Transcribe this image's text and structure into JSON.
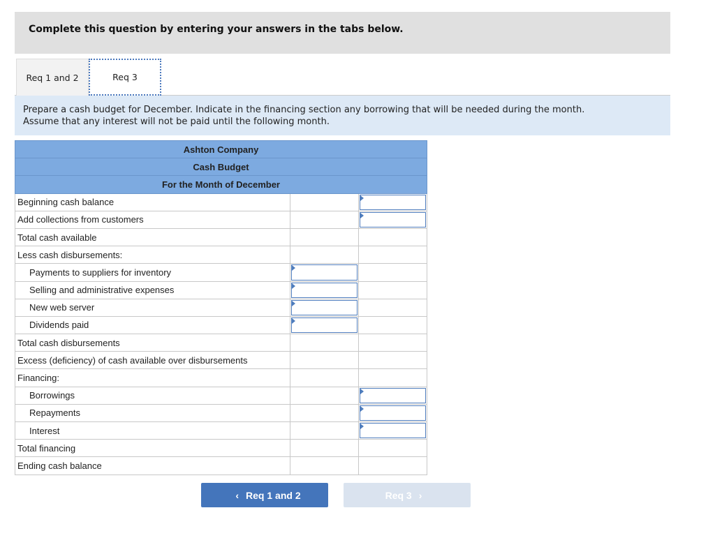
{
  "instruction": "Complete this question by entering your answers in the tabs below.",
  "tabs": [
    {
      "label": "Req 1 and 2",
      "active": false
    },
    {
      "label": "Req 3",
      "active": true
    }
  ],
  "description_line1": "Prepare a cash budget for December. Indicate in the financing section any borrowing that will be needed during the month.",
  "description_line2": "Assume that any interest will not be paid until the following month.",
  "table": {
    "header": [
      "Ashton Company",
      "Cash Budget",
      "For the Month of December"
    ],
    "rows": [
      {
        "label": "Beginning cash balance",
        "indent": false,
        "input_col": 2
      },
      {
        "label": "Add collections from customers",
        "indent": false,
        "input_col": 2
      },
      {
        "label": "Total cash available",
        "indent": false,
        "input_col": 0
      },
      {
        "label": "Less cash disbursements:",
        "indent": false,
        "input_col": 0
      },
      {
        "label": "Payments to suppliers for inventory",
        "indent": true,
        "input_col": 1
      },
      {
        "label": "Selling and administrative expenses",
        "indent": true,
        "input_col": 1
      },
      {
        "label": "New web server",
        "indent": true,
        "input_col": 1
      },
      {
        "label": "Dividends paid",
        "indent": true,
        "input_col": 1
      },
      {
        "label": "Total cash disbursements",
        "indent": false,
        "input_col": 0
      },
      {
        "label": "Excess (deficiency) of cash available over disbursements",
        "indent": false,
        "input_col": 0
      },
      {
        "label": "Financing:",
        "indent": false,
        "input_col": 0
      },
      {
        "label": "Borrowings",
        "indent": true,
        "input_col": 2
      },
      {
        "label": "Repayments",
        "indent": true,
        "input_col": 2
      },
      {
        "label": "Interest",
        "indent": true,
        "input_col": 2
      },
      {
        "label": "Total financing",
        "indent": false,
        "input_col": 0
      },
      {
        "label": "Ending cash balance",
        "indent": false,
        "input_col": 0
      }
    ]
  },
  "nav": {
    "prev_label": "Req 1 and 2",
    "next_label": "Req 3",
    "prev_icon": "‹",
    "next_icon": "›"
  }
}
